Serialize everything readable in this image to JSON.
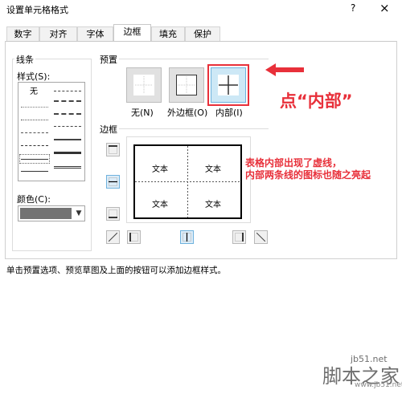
{
  "dialog": {
    "title": "设置单元格格式",
    "help": "?",
    "close": "×"
  },
  "tabs": [
    {
      "label": "数字"
    },
    {
      "label": "对齐"
    },
    {
      "label": "字体"
    },
    {
      "label": "边框",
      "selected": true
    },
    {
      "label": "填充"
    },
    {
      "label": "保护"
    }
  ],
  "lines_group": {
    "title": "线条",
    "style_label": "样式(S):",
    "none_item": "无",
    "color_label": "颜色(C):",
    "color_value": "#737373",
    "dropdown_icon": "chevron-down-icon"
  },
  "preset_group": {
    "title": "预置",
    "buttons": [
      {
        "label": "无(N)",
        "icon": "preset-none-icon"
      },
      {
        "label": "外边框(O)",
        "icon": "preset-outline-icon"
      },
      {
        "label": "内部(I)",
        "icon": "preset-inside-icon",
        "highlighted": true
      }
    ]
  },
  "border_group": {
    "title": "边框",
    "preview_cells": [
      "文本",
      "文本",
      "文本",
      "文本"
    ]
  },
  "hint": "单击预置选项、预览草图及上面的按钮可以添加边框样式。",
  "annotations": {
    "click_inside": "点“内部”",
    "note_line1": "表格内部出现了虚线，",
    "note_line2": "内部两条线的图标也随之亮起",
    "accent_color": "#e8303a"
  },
  "watermark": {
    "url": "jb51.net",
    "brand": "脚本之家",
    "sub": "www.jb51.net"
  }
}
